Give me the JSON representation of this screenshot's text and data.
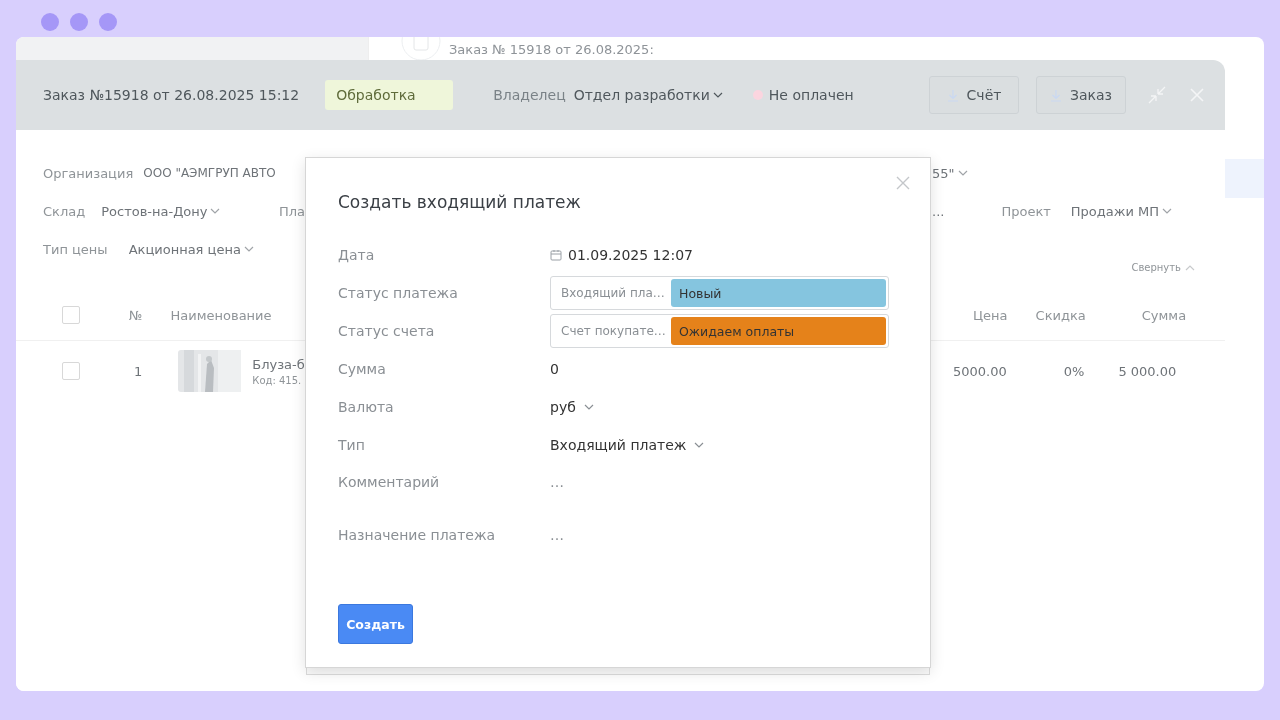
{
  "back_page": {
    "title": "Заказ № 15918 от 26.08.2025:"
  },
  "order": {
    "title": "Заказ №15918 от 26.08.2025 15:12",
    "status": "Обработка",
    "owner_label": "Владелец",
    "owner": "Отдел разработки",
    "payment": {
      "text": "Не оплачен",
      "color": "#fbd5df"
    },
    "buttons": [
      "Счёт",
      "Заказ"
    ]
  },
  "form": {
    "organization": {
      "label": "Организация",
      "value": "ООО \"АЭМГРУП АВТО",
      "tail": "55\""
    },
    "warehouse": {
      "label": "Склад",
      "value": "Ростов-на-Дону"
    },
    "payer": {
      "label": "Пла",
      "tail": "..."
    },
    "project": {
      "label": "Проект",
      "value": "Продажи МП"
    },
    "price_type": {
      "label": "Тип цены",
      "value": "Акционная цена"
    },
    "collapse": "Свернуть"
  },
  "table": {
    "header_checked": false,
    "columns": [
      "№",
      "Наименование",
      "Цена",
      "Скидка",
      "Сумма"
    ],
    "rows": [
      {
        "checked": false,
        "number": "1",
        "name": "Блуза-б",
        "code": "Код: 415.",
        "price": "5000.00",
        "discount": "0%",
        "total": "5 000.00"
      }
    ]
  },
  "dialog": {
    "title": "Создать входящий платеж",
    "fields": [
      {
        "kind": "date",
        "label": "Дата",
        "value": "01.09.2025 12:07"
      },
      {
        "kind": "status",
        "label": "Статус платежа",
        "type": "Входящий пла…",
        "status": "Новый",
        "color": "#85c5df"
      },
      {
        "kind": "status",
        "label": "Статус счета",
        "type": "Счет покупате…",
        "status": "Ожидаем оплаты",
        "color": "#e5821a"
      },
      {
        "kind": "text",
        "label": "Сумма",
        "value": "0"
      },
      {
        "kind": "select",
        "label": "Валюта",
        "value": "руб"
      },
      {
        "kind": "select",
        "label": "Тип",
        "value": "Входящий платеж"
      },
      {
        "kind": "note",
        "label": "Комментарий",
        "value": "…"
      },
      {
        "kind": "note",
        "label": "Назначение платежа",
        "value": "…"
      }
    ],
    "submit": "Создать"
  }
}
